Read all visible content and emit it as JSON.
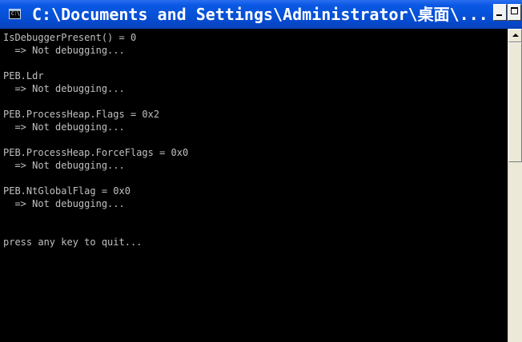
{
  "window": {
    "title": "C:\\Documents and Settings\\Administrator\\桌面\\...",
    "icon_text": "C:\\",
    "buttons": [
      "minimize",
      "maximize"
    ]
  },
  "console": {
    "lines": [
      "IsDebuggerPresent() = 0",
      "  => Not debugging...",
      "",
      "PEB.Ldr",
      "  => Not debugging...",
      "",
      "PEB.ProcessHeap.Flags = 0x2",
      "  => Not debugging...",
      "",
      "PEB.ProcessHeap.ForceFlags = 0x0",
      "  => Not debugging...",
      "",
      "PEB.NtGlobalFlag = 0x0",
      "  => Not debugging...",
      "",
      "",
      "press any key to quit..."
    ]
  },
  "colors": {
    "titlebar": "#0652d8",
    "console_background": "#000000",
    "console_text": "#c0c0c0"
  }
}
